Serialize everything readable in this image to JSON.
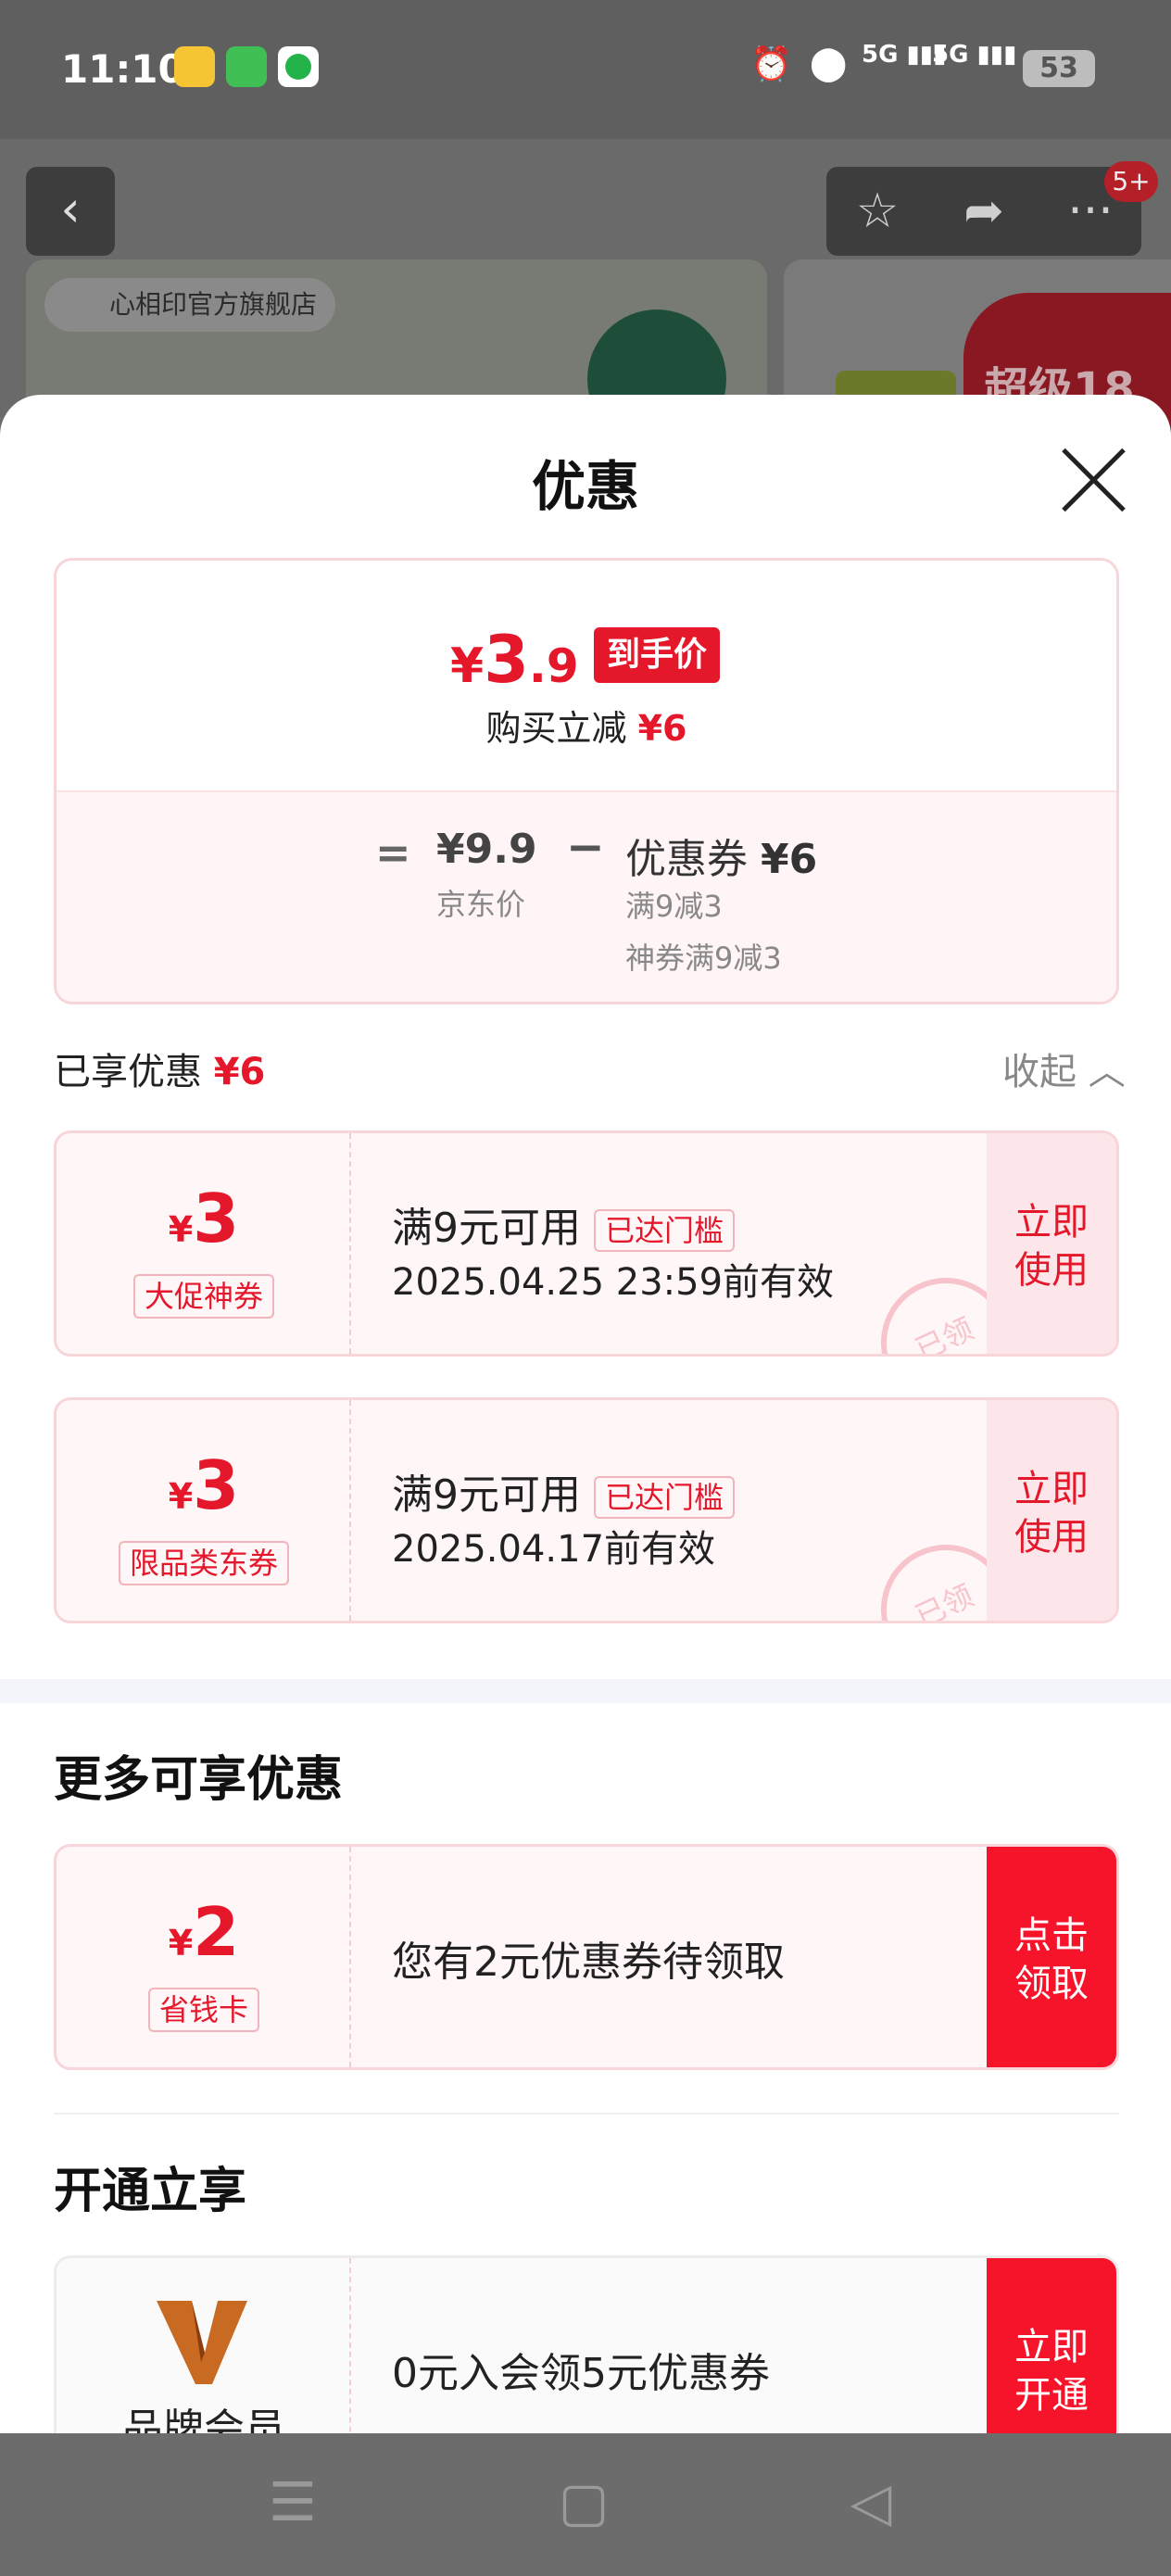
{
  "status_bar": {
    "time": "11:10",
    "battery": "53",
    "network1": "5G",
    "network2": "5G"
  },
  "product_header": {
    "store_name": "心相印官方旗舰店",
    "cart_badge": "5+",
    "promo_text": "超级18"
  },
  "sheet": {
    "title": "优惠",
    "summary": {
      "currency": "¥",
      "final_int": "3",
      "final_dec": ".9",
      "final_tag": "到手价",
      "reduce_label": "购买立减",
      "reduce_amount": "¥6",
      "equals": "=",
      "jd_price": "¥9.9",
      "jd_label": "京东价",
      "minus": "−",
      "coupon_label": "优惠券",
      "coupon_amount": "¥6",
      "coupon_detail1": "满9减3",
      "coupon_detail2": "神券满9减3"
    },
    "enjoyed_label": "已享优惠",
    "enjoyed_amount": "¥6",
    "collapse_label": "收起",
    "coupons": [
      {
        "currency": "¥",
        "amount": "3",
        "type": "大促神券",
        "condition": "满9元可用",
        "tag": "已达门槛",
        "expiry": "2025.04.25 23:59前有效",
        "action": "立即使用",
        "stamp": "已领"
      },
      {
        "currency": "¥",
        "amount": "3",
        "type": "限品类东券",
        "condition": "满9元可用",
        "tag": "已达门槛",
        "expiry": "2025.04.17前有效",
        "action": "立即使用",
        "stamp": "已领"
      }
    ],
    "more_title": "更多可享优惠",
    "more_offer": {
      "currency": "¥",
      "amount": "2",
      "type": "省钱卡",
      "desc": "您有2元优惠券待领取",
      "action": "点击领取"
    },
    "open_title": "开通立享",
    "member_offer": {
      "name": "品牌会员",
      "desc": "0元入会领5元优惠券",
      "action": "立即开通"
    }
  },
  "colors": {
    "accent": "#e5172b",
    "sheet_bg": "#ffffff",
    "coupon_bg": "#fff6f7"
  }
}
